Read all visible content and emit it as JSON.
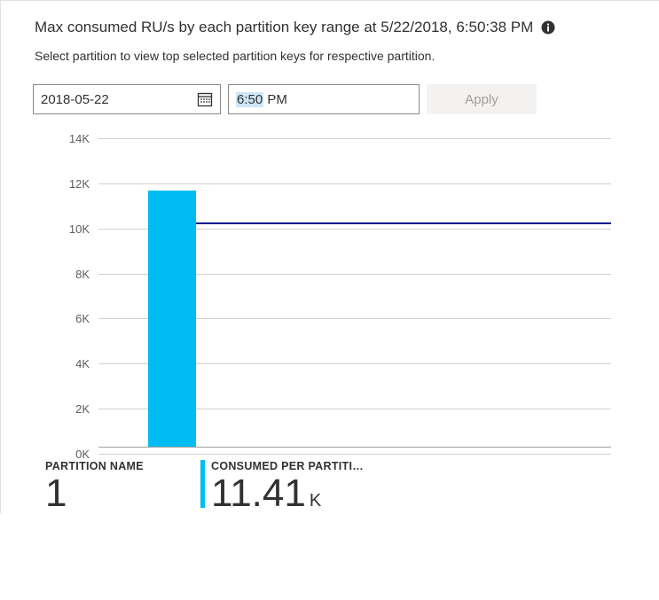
{
  "header": {
    "title": "Max consumed RU/s by each partition key range at 5/22/2018, 6:50:38 PM",
    "subtitle": "Select partition to view top selected partition keys for respective partition."
  },
  "controls": {
    "date_value": "2018-05-22",
    "time_hour": "6:50",
    "time_rest": " PM",
    "apply_label": "Apply"
  },
  "chart_data": {
    "type": "bar",
    "categories": [
      "1"
    ],
    "values": [
      11410
    ],
    "threshold": 10000,
    "ylim": [
      0,
      14000
    ],
    "y_ticks": [
      "14K",
      "12K",
      "10K",
      "8K",
      "6K",
      "4K",
      "2K",
      "0K"
    ],
    "title": "Max consumed RU/s by each partition key range",
    "xlabel": "",
    "ylabel": ""
  },
  "metrics": {
    "partition_name_label": "PARTITION NAME",
    "partition_name_value": "1",
    "consumed_label": "CONSUMED PER PARTITI…",
    "consumed_value": "11.41",
    "consumed_unit": "K"
  },
  "icons": {
    "info": "info-icon",
    "calendar": "calendar-icon"
  }
}
